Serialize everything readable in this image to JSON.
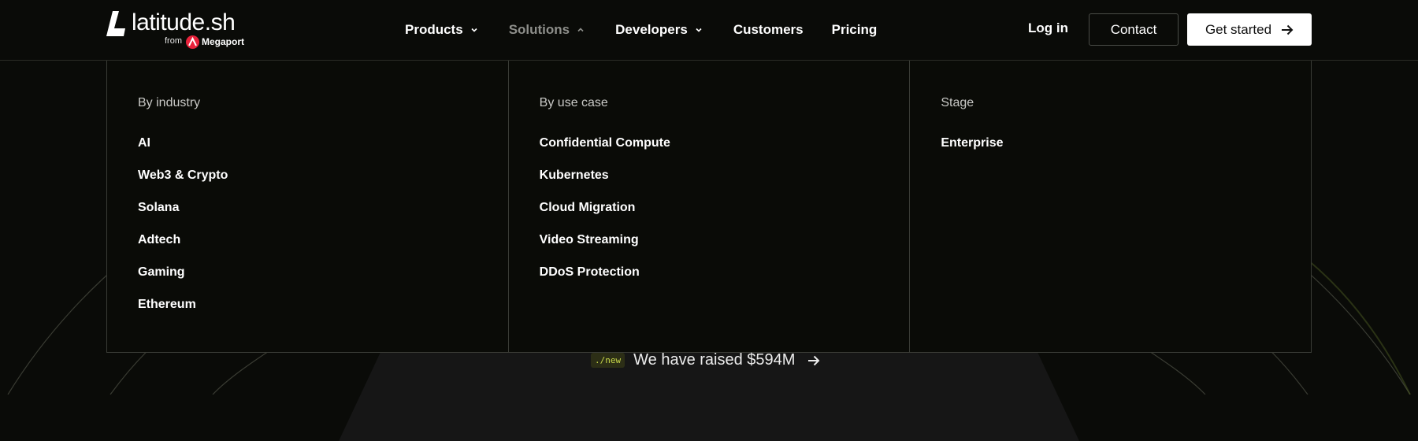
{
  "brand": {
    "name": "latitude.sh",
    "from": "from",
    "partner": "Megaport",
    "partner_color": "#e8223b"
  },
  "nav": {
    "items": [
      {
        "label": "Products",
        "has_dropdown": true,
        "expanded": false
      },
      {
        "label": "Solutions",
        "has_dropdown": true,
        "expanded": true
      },
      {
        "label": "Developers",
        "has_dropdown": true,
        "expanded": false
      },
      {
        "label": "Customers",
        "has_dropdown": false
      },
      {
        "label": "Pricing",
        "has_dropdown": false
      }
    ],
    "login_label": "Log in",
    "contact_label": "Contact",
    "get_started_label": "Get started"
  },
  "solutions_menu": {
    "columns": [
      {
        "title": "By industry",
        "items": [
          "AI",
          "Web3 & Crypto",
          "Solana",
          "Adtech",
          "Gaming",
          "Ethereum"
        ]
      },
      {
        "title": "By use case",
        "items": [
          "Confidential Compute",
          "Kubernetes",
          "Cloud Migration",
          "Video Streaming",
          "DDoS Protection"
        ]
      },
      {
        "title": "Stage",
        "items": [
          "Enterprise"
        ]
      }
    ]
  },
  "announcement": {
    "badge": "./new",
    "text": "We have raised $594M"
  },
  "colors": {
    "background": "#0a0b08",
    "border": "#3a3c36",
    "active_nav": "#8e8f8b",
    "badge_text": "#c8d84a"
  }
}
